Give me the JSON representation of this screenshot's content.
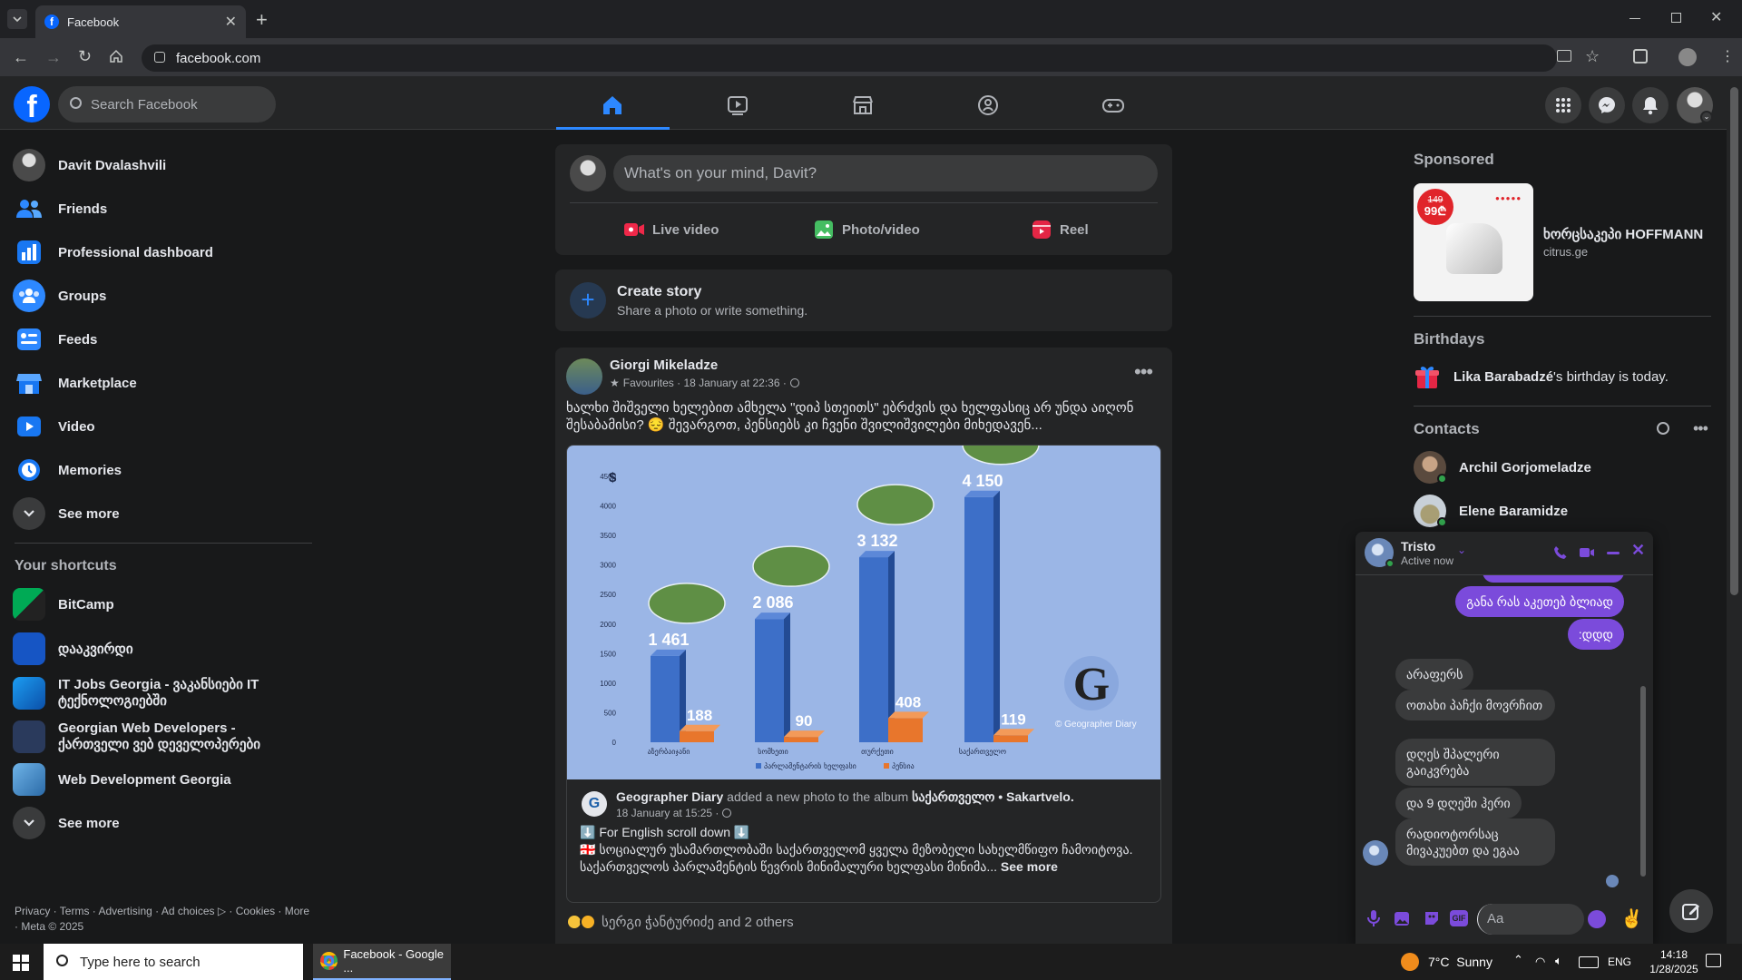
{
  "browser": {
    "tab_title": "Facebook",
    "url": "facebook.com"
  },
  "header": {
    "search_placeholder": "Search Facebook"
  },
  "left_nav": {
    "items": [
      {
        "label": "Davit Dvalashvili",
        "icon": "avatar"
      },
      {
        "label": "Friends",
        "icon": "friends-icon"
      },
      {
        "label": "Professional dashboard",
        "icon": "dashboard-icon"
      },
      {
        "label": "Groups",
        "icon": "groups-icon"
      },
      {
        "label": "Feeds",
        "icon": "feeds-icon"
      },
      {
        "label": "Marketplace",
        "icon": "marketplace-icon"
      },
      {
        "label": "Video",
        "icon": "video-icon"
      },
      {
        "label": "Memories",
        "icon": "memories-icon"
      },
      {
        "label": "See more",
        "icon": "chevron-down-icon"
      }
    ],
    "shortcuts_title": "Your shortcuts",
    "shortcuts": [
      {
        "label": "BitCamp"
      },
      {
        "label": "დააკვირდი"
      },
      {
        "label": "IT Jobs Georgia - ვაკანსიები IT ტექნოლოგიებში"
      },
      {
        "label": "Georgian Web Developers - ქართველი ვებ დეველოპერები"
      },
      {
        "label": "Web Development Georgia"
      },
      {
        "label": "See more"
      }
    ],
    "footer": "Privacy · Terms · Advertising · Ad choices ▷ · Cookies · More · Meta © 2025"
  },
  "composer": {
    "placeholder": "What's on your mind, Davit?",
    "live": "Live video",
    "photo": "Photo/video",
    "reel": "Reel"
  },
  "story": {
    "title": "Create story",
    "subtitle": "Share a photo or write something."
  },
  "post": {
    "author": "Giorgi Mikeladze",
    "meta": "Favourites · 18 January at 22:36 ·",
    "text": "ხალხი შიშველი ხელებით ამხელა \"დიპ სთეითს\" ებრძვის და ხელფასიც არ უნდა აიღონ შესაბამისი? 😔 შევარგოთ, პენსიებს კი ჩვენი შვილიშვილები მიხედავენ...",
    "shared_author": "Geographer Diary",
    "shared_action": "added a new photo to the album",
    "shared_album": "საქართველო • Sakartvelo.",
    "shared_meta": "18 January at 15:25 ·",
    "shared_line1": "⬇️ For English scroll down ⬇️",
    "shared_line2": "🇬🇪 სოციალურ უსამართლობაში საქართველომ ყველა მეზობელი სახელმწიფო ჩამოიტოვა. საქართველოს პარლამენტის წევრის მინიმალური ხელფასი მინიმა...",
    "see_more": "See more",
    "reactions": "სერგი ჭანტურიძე and 2 others"
  },
  "chart_data": {
    "type": "bar",
    "ylabel": "$",
    "ylim": [
      0,
      4500
    ],
    "yticks": [
      0,
      500,
      1000,
      1500,
      2000,
      2500,
      3000,
      3500,
      4000,
      4500
    ],
    "categories": [
      "აზერბაიჯანი",
      "სომხეთი",
      "თურქეთი",
      "საქართველო"
    ],
    "series": [
      {
        "name": "პარლამენტარის ხელფასი",
        "values": [
          1461,
          2086,
          3132,
          4150
        ],
        "labels": [
          "1 461",
          "2 086",
          "3 132",
          "4 150"
        ],
        "color": "#3d6fc8"
      },
      {
        "name": "პენსია",
        "values": [
          188,
          90,
          408,
          119
        ],
        "labels": [
          "188",
          "90",
          "408",
          "119"
        ],
        "color": "#e8762c"
      }
    ],
    "watermark": "© Geographer Diary"
  },
  "right_rail": {
    "sponsored_title": "Sponsored",
    "ad_title": "ხორცსაკეპი HOFFMANN",
    "ad_domain": "citrus.ge",
    "ad_price_old": "149",
    "ad_price_new": "99₾",
    "birthdays_title": "Birthdays",
    "birthday_name": "Lika Barabadzé",
    "birthday_text": "'s birthday is today.",
    "contacts_title": "Contacts",
    "contacts": [
      {
        "name": "Archil Gorjomeladze"
      },
      {
        "name": "Elene Baramidze"
      }
    ]
  },
  "chat": {
    "name": "Tristo",
    "status": "Active now",
    "messages_right": [
      "განა რას აკეთებ ბლიად",
      ":დდდ"
    ],
    "messages_left": [
      "არაფერს",
      "ოთახი პაჩქი მოვრჩით",
      "დღეს შპალერი გაიკვრება",
      "და 9 დღეში ჰერი",
      "რადიოტორსაც მივაკუებთ და ეგაა"
    ],
    "input_placeholder": "Aa"
  },
  "taskbar": {
    "search_placeholder": "Type here to search",
    "app_label": "Facebook - Google ...",
    "weather": "7°C  Sunny",
    "lang": "ENG",
    "time": "14:18",
    "date": "1/28/2025"
  },
  "colors": {
    "fb_blue": "#0866ff",
    "purple": "#7b4bdb",
    "bg": "#18191a",
    "card": "#242526"
  }
}
